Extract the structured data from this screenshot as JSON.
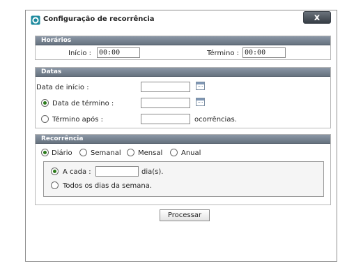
{
  "dialog": {
    "title": "Configuração de recorrência",
    "close_label": "x",
    "icon": "app-logo-icon",
    "accent_color": "#1d8a9e"
  },
  "horarios": {
    "header": "Horários",
    "start_label": "Início :",
    "start_value": "00:00",
    "end_label": "Término :",
    "end_value": "00:00"
  },
  "datas": {
    "header": "Datas",
    "start_date_label": "Data de início :",
    "start_date_value": "",
    "end_date_label": "Data de término :",
    "end_date_value": "",
    "end_date_selected": true,
    "end_after_label": "Término após :",
    "end_after_value": "",
    "end_after_selected": false,
    "occurrences_label": "ocorrências.",
    "calendar_icon": "calendar-icon"
  },
  "recorrencia": {
    "header": "Recorrência",
    "options": [
      {
        "label": "Diário",
        "selected": true
      },
      {
        "label": "Semanal",
        "selected": false
      },
      {
        "label": "Mensal",
        "selected": false
      },
      {
        "label": "Anual",
        "selected": false
      }
    ],
    "every_label": "A cada :",
    "every_value": "",
    "every_unit": "dia(s).",
    "every_selected": true,
    "weekdays_label": "Todos os dias da semana.",
    "weekdays_selected": false
  },
  "submit_label": "Processar"
}
